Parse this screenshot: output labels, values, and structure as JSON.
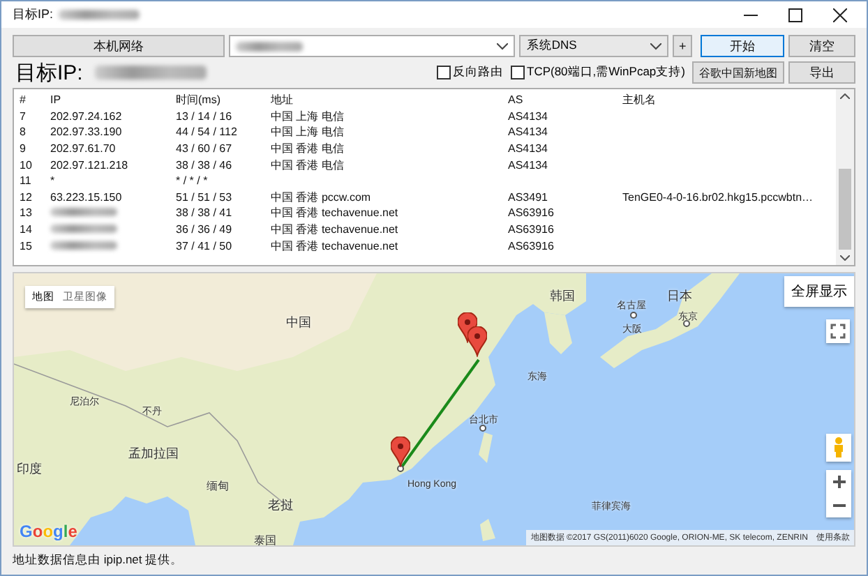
{
  "window": {
    "title": "目标IP:"
  },
  "toolbar": {
    "network_button": "本机网络",
    "dns_combo": {
      "value": "系统DNS"
    },
    "add_button": "+",
    "start_button": "开始",
    "clear_button": "清空",
    "target_label": "目标IP:",
    "options": [
      {
        "label": "反向路由",
        "checked": false
      },
      {
        "label": "TCP(80端口,需WinPcap支持)",
        "checked": false
      }
    ],
    "map_button": "谷歌中国新地图",
    "export_button": "导出"
  },
  "table": {
    "columns": [
      "#",
      "IP",
      "时间(ms)",
      "地址",
      "AS",
      "主机名"
    ],
    "rows": [
      {
        "num": "7",
        "ip": "202.97.24.162",
        "time": "13 / 14 / 16",
        "location": "中国 上海 电信",
        "as": "AS4134"
      },
      {
        "num": "8",
        "ip": "202.97.33.190",
        "time": "44 / 54 / 112",
        "location": "中国 上海 电信",
        "as": "AS4134"
      },
      {
        "num": "9",
        "ip": "202.97.61.70",
        "time": "43 / 60 / 67",
        "location": "中国 香港 电信",
        "as": "AS4134"
      },
      {
        "num": "10",
        "ip": "202.97.121.218",
        "time": "38 / 38 / 46",
        "location": "中国 香港 电信",
        "as": "AS4134"
      },
      {
        "num": "11",
        "ip": "*",
        "time": "* / * / *"
      },
      {
        "num": "12",
        "ip": "63.223.15.150",
        "time": "51 / 51 / 53",
        "location": "中国 香港 pccw.com",
        "as": "AS3491",
        "host": "TenGE0-4-0-16.br02.hkg15.pccwbtn…"
      },
      {
        "num": "13",
        "time": "38 / 38 / 41",
        "location": "中国 香港 techavenue.net",
        "as": "AS63916"
      },
      {
        "num": "14",
        "time": "36 / 36 / 49",
        "location": "中国 香港 techavenue.net",
        "as": "AS63916"
      },
      {
        "num": "15",
        "time": "37 / 41 / 50",
        "location": "中国 香港 techavenue.net",
        "as": "AS63916"
      }
    ]
  },
  "map": {
    "tabs": [
      {
        "label": "地图",
        "selected": true
      },
      {
        "label": "卫星图像",
        "selected": false
      }
    ],
    "fullscreen_button": "全屏显示",
    "places": [
      "中国",
      "韩国",
      "日本",
      "名古屋",
      "大阪",
      "东京",
      "东海",
      "尼泊尔",
      "不丹",
      "孟加拉国",
      "印度",
      "缅甸",
      "老挝",
      "泰国",
      "台北市",
      "Hong Kong",
      "菲律宾海"
    ],
    "logo": "Google",
    "attribution": "地图数据 ©2017 GS(2011)6020 Google, ORION-ME, SK telecom, ZENRIN",
    "terms_link": "使用条款"
  },
  "status_bar": "地址数据信息由 ipip.net 提供。"
}
